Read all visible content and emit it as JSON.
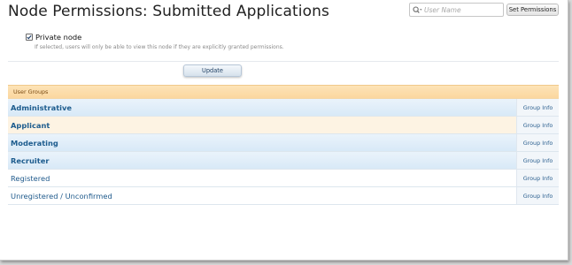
{
  "header": {
    "title": "Node Permissions: Submitted Applications",
    "search_placeholder": "User Name",
    "set_permissions_label": "Set Permissions"
  },
  "options": {
    "private_node_label": "Private node",
    "private_node_checked": true,
    "private_node_hint": "If selected, users will only be able to view this node if they are explicitly granted permissions."
  },
  "actions": {
    "update_label": "Update"
  },
  "user_groups": {
    "header": "User Groups",
    "info_label": "Group Info",
    "items": [
      {
        "name": "Administrative",
        "bold": true,
        "style": "blue"
      },
      {
        "name": "Applicant",
        "bold": true,
        "style": "peach"
      },
      {
        "name": "Moderating",
        "bold": true,
        "style": "blue"
      },
      {
        "name": "Recruiter",
        "bold": true,
        "style": "blue"
      },
      {
        "name": "Registered",
        "bold": false,
        "style": "white"
      },
      {
        "name": "Unregistered / Unconfirmed",
        "bold": false,
        "style": "white"
      }
    ]
  },
  "colors": {
    "accent": "#1d5c8e",
    "header_band": "#fbd79f",
    "row_highlight": "#d8e9f7"
  }
}
